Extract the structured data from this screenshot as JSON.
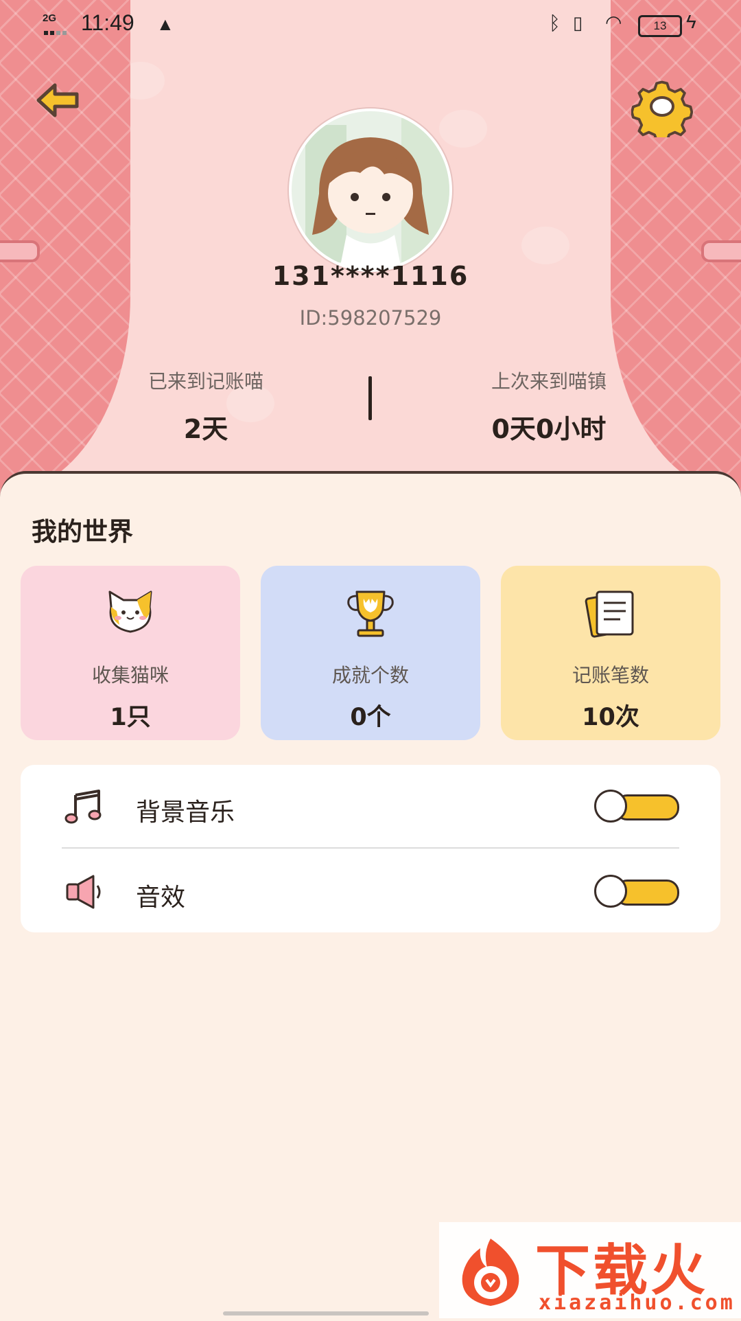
{
  "status_bar": {
    "network": "2G",
    "time": "11:49",
    "battery": "13"
  },
  "profile": {
    "phone": "131****1116",
    "id": "ID:598207529"
  },
  "stats": [
    {
      "label": "已来到记账喵",
      "value": "2天"
    },
    {
      "label": "上次来到喵镇",
      "value": "0天0小时"
    }
  ],
  "world": {
    "title": "我的世界",
    "cards": [
      {
        "label": "收集猫咪",
        "value": "1只",
        "icon": "cat-face-icon",
        "color": "#fbd6de"
      },
      {
        "label": "成就个数",
        "value": "0个",
        "icon": "trophy-icon",
        "color": "#d2dcf7"
      },
      {
        "label": "记账笔数",
        "value": "10次",
        "icon": "receipt-icon",
        "color": "#fde4a9"
      }
    ]
  },
  "settings": [
    {
      "label": "背景音乐",
      "icon": "music-note-icon",
      "enabled": true
    },
    {
      "label": "音效",
      "icon": "speaker-icon",
      "enabled": true
    }
  ],
  "watermark": {
    "text": "下载火",
    "url": "xiazaihuo.com"
  },
  "colors": {
    "accent_yellow": "#f6c12c",
    "header_pink": "#fbd9d6",
    "curtain": "#ef8e90"
  }
}
